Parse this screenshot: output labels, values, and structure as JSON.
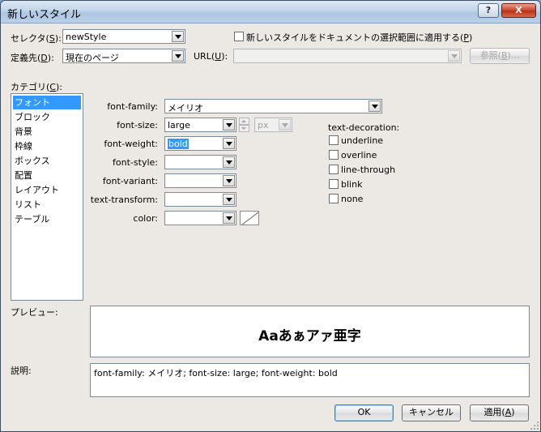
{
  "window": {
    "title": "新しいスタイル",
    "help_button": "?",
    "close_button": "X"
  },
  "selector": {
    "label": "セレクタ(",
    "accel": "S",
    "label_end": "):",
    "value": "newStyle"
  },
  "apply_to_selection": {
    "label": "新しいスタイルをドキュメントの選択範囲に適用する(",
    "accel": "P",
    "label_end": ")",
    "checked": false
  },
  "define_in": {
    "label": "定義先(",
    "accel": "D",
    "label_end": "):",
    "value": "現在のページ"
  },
  "url": {
    "label": "URL(",
    "accel": "U",
    "label_end": "):",
    "value": ""
  },
  "browse_button": {
    "label": "参照(",
    "accel": "B",
    "label_end": ")..."
  },
  "category": {
    "label": "カテゴリ(",
    "accel": "C",
    "label_end": "):",
    "items": [
      "フォント",
      "ブロック",
      "背景",
      "枠線",
      "ボックス",
      "配置",
      "レイアウト",
      "リスト",
      "テーブル"
    ],
    "selected_index": 0
  },
  "font": {
    "family_label": "font-family:",
    "family_value": "メイリオ",
    "size_label": "font-size:",
    "size_value": "large",
    "size_unit": "px",
    "weight_label": "font-weight:",
    "weight_value": "bold",
    "style_label": "font-style:",
    "style_value": "",
    "variant_label": "font-variant:",
    "variant_value": "",
    "transform_label": "text-transform:",
    "transform_value": "",
    "color_label": "color:",
    "color_value": ""
  },
  "text_decoration": {
    "label": "text-decoration:",
    "options": [
      "underline",
      "overline",
      "line-through",
      "blink",
      "none"
    ]
  },
  "preview": {
    "label": "プレビュー:",
    "sample": "Aaあぁアァ亜字"
  },
  "description": {
    "label": "説明:",
    "text": "font-family: メイリオ; font-size: large; font-weight: bold"
  },
  "buttons": {
    "ok": "OK",
    "cancel": "キャンセル",
    "apply": "適用(",
    "apply_accel": "A",
    "apply_end": ")"
  },
  "colors": {
    "selection": "#3399ff",
    "dialog_bg": "#ece9e4"
  }
}
